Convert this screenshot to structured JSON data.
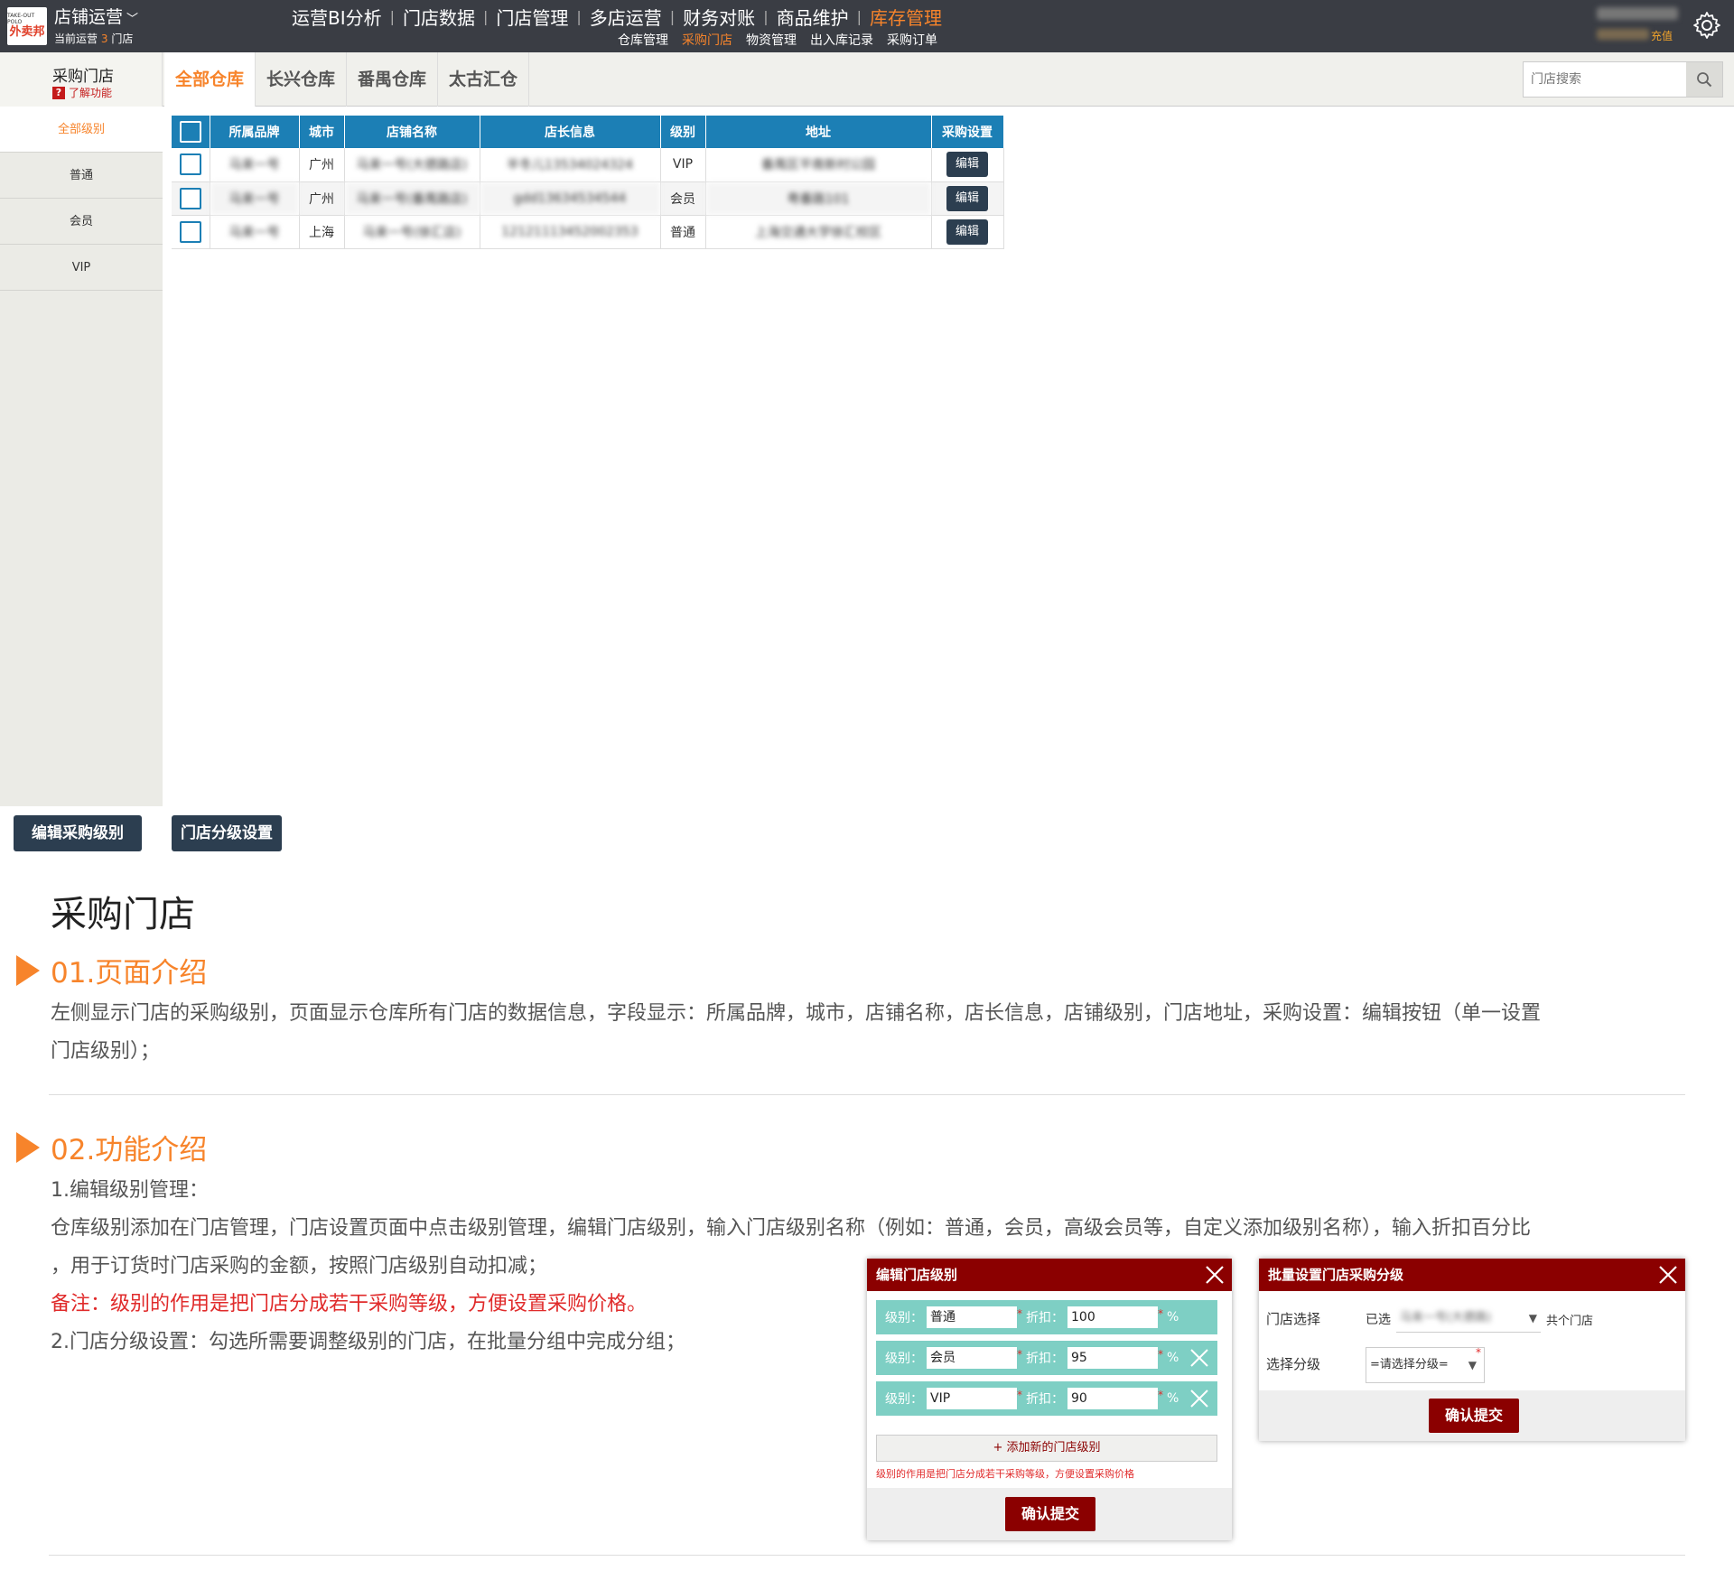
{
  "topbar": {
    "logo_top": "TAKE-OUT POLO",
    "logo_main": "外卖邦",
    "store_ops": "店铺运营",
    "store_sub_prefix": "当前运营",
    "store_sub_num": "3",
    "store_sub_suffix": "门店",
    "nav": [
      "运营BI分析",
      "门店数据",
      "门店管理",
      "多店运营",
      "财务对账",
      "商品维护",
      "库存管理"
    ],
    "subnav": [
      "仓库管理",
      "采购门店",
      "物资管理",
      "出入库记录",
      "采购订单"
    ],
    "recharge": "充值"
  },
  "page": {
    "title": "采购门店",
    "help": "了解功能"
  },
  "warehouse_tabs": [
    "全部仓库",
    "长兴仓库",
    "番禺仓库",
    "太古汇仓"
  ],
  "search": {
    "placeholder": "门店搜索"
  },
  "sidebar": [
    "全部级别",
    "普通",
    "会员",
    "VIP"
  ],
  "table": {
    "headers": [
      "所属品牌",
      "城市",
      "店铺名称",
      "店长信息",
      "级别",
      "地址",
      "采购设置"
    ],
    "rows": [
      {
        "brand": "马来一号",
        "city": "广州",
        "name": "马来一号(大德路店)",
        "manager": "半冬儿13534024324",
        "level": "VIP",
        "address": "番禺区平南新村公园",
        "action": "编辑"
      },
      {
        "brand": "马来一号",
        "city": "广州",
        "name": "马来一号(番禺路店)",
        "manager": "gdd13634534544",
        "level": "会员",
        "address": "粤番路101",
        "action": "编辑"
      },
      {
        "brand": "马来一号",
        "city": "上海",
        "name": "马来一号(徐汇店)",
        "manager": "12121113452002353",
        "level": "普通",
        "address": "上海交通大学徐汇校区",
        "action": "编辑"
      }
    ]
  },
  "actions": {
    "edit_level": "编辑采购级别",
    "group_setting": "门店分级设置"
  },
  "doc": {
    "title": "采购门店",
    "sec1_title": "01.页面介绍",
    "sec1_line1": "左侧显示门店的采购级别，页面显示仓库所有门店的数据信息，字段显示：所属品牌，城市，店铺名称，店长信息，店铺级别，门店地址，采购设置：编辑按钮（单一设置",
    "sec1_line2": "门店级别）；",
    "sec2_title": "02.功能介绍",
    "sec2_l1": "1.编辑级别管理：",
    "sec2_l2": "仓库级别添加在门店管理，门店设置页面中点击级别管理，编辑门店级别，输入门店级别名称（例如：普通，会员，高级会员等，自定义添加级别名称），输入折扣百分比",
    "sec2_l3": "，用于订货时门店采购的金额，按照门店级别自动扣减；",
    "sec2_note": "备注：级别的作用是把门店分成若干采购等级，方便设置采购价格。",
    "sec2_l4": "2.门店分级设置：勾选所需要调整级别的门店，在批量分组中完成分组；"
  },
  "modal_edit": {
    "title": "编辑门店级别",
    "level_label": "级别：",
    "discount_label": "折扣：",
    "percent": "%",
    "star": "*",
    "rows": [
      {
        "level": "普通",
        "discount": "100"
      },
      {
        "level": "会员",
        "discount": "95"
      },
      {
        "level": "VIP",
        "discount": "90"
      }
    ],
    "add": "+ 添加新的门店级别",
    "note": "级别的作用是把门店分成若干采购等级，方便设置采购价格",
    "submit": "确认提交"
  },
  "modal_batch": {
    "title": "批量设置门店采购分级",
    "store_label": "门店选择",
    "selected_prefix": "已选",
    "selected_value": "马来一号(大德路)",
    "selected_suffix": "共个门店",
    "level_label": "选择分级",
    "level_select": "=请选择分级=",
    "submit": "确认提交"
  },
  "colors": {
    "accent": "#f7842b",
    "header_blue": "#1c7fb5",
    "dark_button": "#2c3e50",
    "modal_red": "#8b0000",
    "teal": "#7ecfc4"
  }
}
